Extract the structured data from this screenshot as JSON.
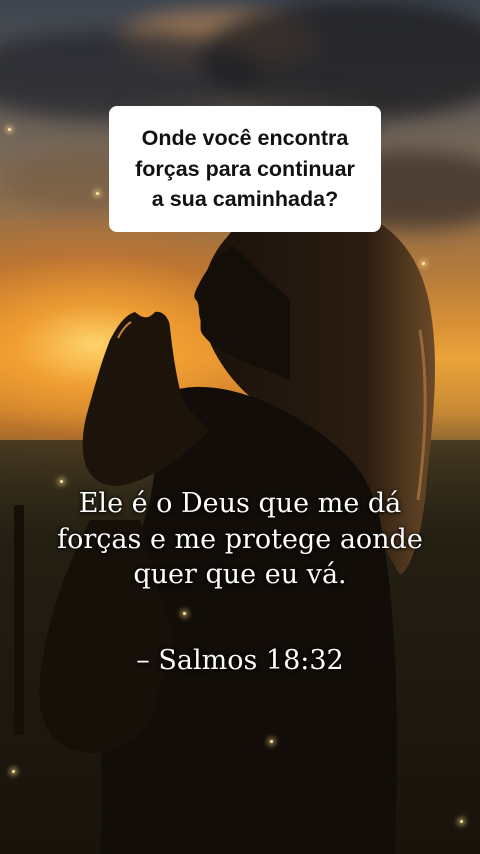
{
  "question": {
    "text": "Onde você encontra\nforças para continuar\na sua caminhada?"
  },
  "verse": {
    "text": "Ele é o Deus que me dá\nforças e me protege aonde\nquer que eu vá.",
    "reference": "– Salmos 18:32"
  },
  "scene": {
    "description_icon": "woman-praying-sunset-silhouette",
    "colors": {
      "sun": "#ffd66e",
      "sky_glow": "#eaa33a",
      "silhouette": "#120d08",
      "text": "#ffffff",
      "box": "#ffffff"
    }
  }
}
